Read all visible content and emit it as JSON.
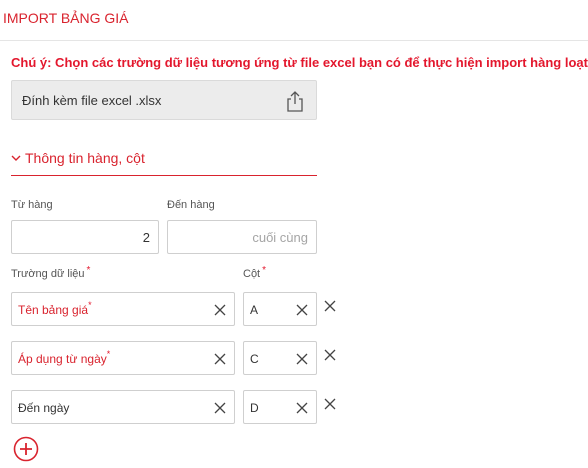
{
  "header": {
    "title": "IMPORT BẢNG GIÁ"
  },
  "note": "Chú ý: Chọn các trường dữ liệu tương ứng từ file excel bạn có để thực hiện import hàng loạt",
  "attach": {
    "label": "Đính kèm file excel .xlsx",
    "icon": "upload-icon"
  },
  "section": {
    "label": "Thông tin hàng, cột",
    "icon": "chevron-down-icon"
  },
  "range": {
    "from_label": "Từ hàng",
    "from_value": "2",
    "to_label": "Đến hàng",
    "to_placeholder": "cuối cùng"
  },
  "mapping": {
    "field_label": "Trường dữ liệu",
    "column_label": "Cột",
    "required_mark": "*",
    "rows": [
      {
        "field": "Tên bảng giá",
        "required": true,
        "column": "A"
      },
      {
        "field": "Áp dụng từ ngày",
        "required": true,
        "column": "C"
      },
      {
        "field": "Đến ngày",
        "required": false,
        "column": "D"
      }
    ]
  },
  "add_button_icon": "plus-circle-icon",
  "colors": {
    "accent": "#d9232e",
    "required": "#e3172d",
    "border": "#cfcfcf"
  }
}
